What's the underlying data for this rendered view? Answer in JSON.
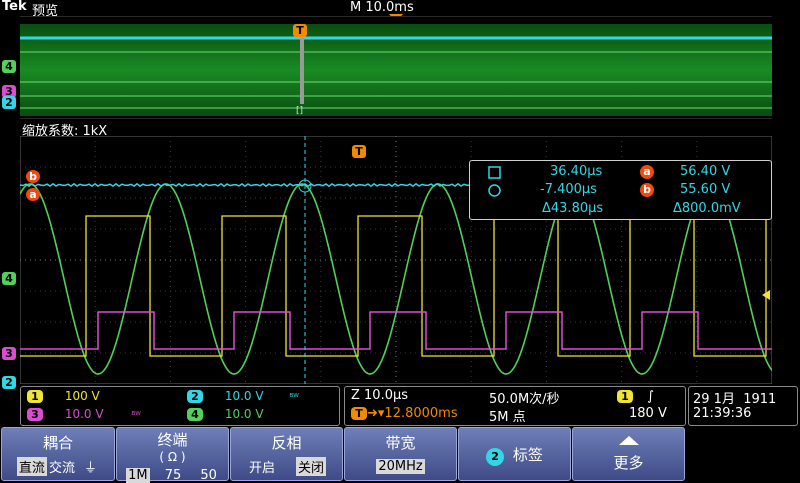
{
  "header": {
    "brand": "Tek",
    "mode": "预览",
    "timebase": "M 10.0ms"
  },
  "zoom_label": "缩放系数: 1kX",
  "trigger_marker": "T",
  "overview_bracket": "[]",
  "channel_markers": {
    "ch4": "4",
    "ch3": "3",
    "ch2": "2",
    "cursor_a": "a",
    "cursor_b": "b"
  },
  "cursor_readout": {
    "t1": "36.40µs",
    "t2": "-7.400µs",
    "dt": "Δ43.80µs",
    "va_label": "a",
    "va": "56.40 V",
    "vb_label": "b",
    "vb": "55.60 V",
    "dv": "Δ800.0mV"
  },
  "channels": [
    {
      "num": "1",
      "scale": "100 V",
      "color": "#f2e432"
    },
    {
      "num": "2",
      "scale": "10.0 V",
      "color": "#33d6e6"
    },
    {
      "num": "3",
      "scale": "10.0 V",
      "color": "#d94ed1"
    },
    {
      "num": "4",
      "scale": "10.0 V",
      "color": "#52d05a"
    }
  ],
  "bw_mark": "ᴮᵂ",
  "horizontal": {
    "zoom": "Z 10.0µs",
    "rate": "50.0M次/秒",
    "delay": "12.8000ms",
    "record": "5M 点"
  },
  "trigger": {
    "source": "1",
    "slope": "∫",
    "level": "180 V"
  },
  "datetime": {
    "date": "29 1月  1911",
    "time": "21:39:36"
  },
  "softkeys": {
    "coupling": {
      "label": "耦合",
      "options": [
        "直流",
        "交流",
        "⏚"
      ]
    },
    "termination": {
      "label": "终端",
      "sub": "( Ω )",
      "options": [
        "1M",
        "75",
        "50"
      ]
    },
    "invert": {
      "label": "反相",
      "options": [
        "开启",
        "关闭"
      ]
    },
    "bandwidth": {
      "label": "带宽",
      "value": "20MHz"
    },
    "label": {
      "num": "2",
      "label": "标签"
    },
    "more": {
      "label": "更多"
    }
  }
}
